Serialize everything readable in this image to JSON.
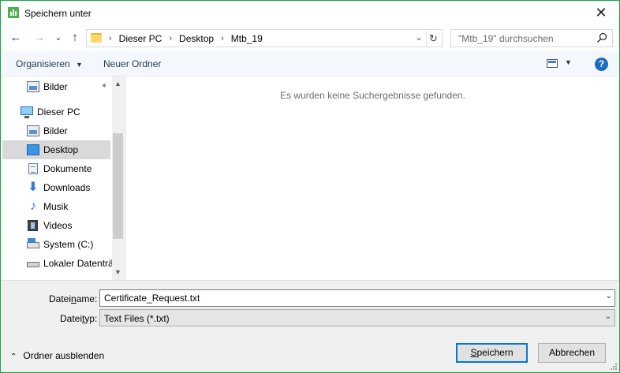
{
  "window": {
    "title": "Speichern unter",
    "close_glyph": "✕",
    "accent_color": "#1aa34a"
  },
  "nav": {
    "back_glyph": "←",
    "forward_glyph": "→",
    "recent_glyph": "⌄",
    "up_glyph": "↑",
    "breadcrumb": [
      "Dieser PC",
      "Desktop",
      "Mtb_19"
    ],
    "breadcrumb_sep": "›",
    "dropdown_glyph": "⌄",
    "refresh_glyph": "↻",
    "search_placeholder": "\"Mtb_19\" durchsuchen"
  },
  "toolbar": {
    "organize_label": "Organisieren",
    "organize_caret": "▼",
    "new_folder_label": "Neuer Ordner",
    "view_caret": "▼",
    "help_glyph": "?"
  },
  "navpane": {
    "items": [
      {
        "label": "Bilder",
        "icon": "pictures-icon",
        "pinned": true
      },
      {
        "label": "Dieser PC",
        "icon": "computer-icon"
      },
      {
        "label": "Bilder",
        "icon": "pictures-icon"
      },
      {
        "label": "Desktop",
        "icon": "desktop-icon",
        "selected": true
      },
      {
        "label": "Dokumente",
        "icon": "documents-icon"
      },
      {
        "label": "Downloads",
        "icon": "download-icon"
      },
      {
        "label": "Musik",
        "icon": "music-icon"
      },
      {
        "label": "Videos",
        "icon": "videos-icon"
      },
      {
        "label": "System (C:)",
        "icon": "drive-icon"
      },
      {
        "label": "Lokaler Datenträ",
        "icon": "drive-icon"
      }
    ],
    "pin_glyph": "📌",
    "down_glyph": "⬇",
    "music_glyph": "♪",
    "scroll_up": "▲",
    "scroll_down": "▼"
  },
  "content": {
    "empty_message": "Es wurden keine Suchergebnisse gefunden."
  },
  "form": {
    "filename_label_pre": "Datei",
    "filename_label_key": "n",
    "filename_label_post": "ame:",
    "filename_value": "Certificate_Request.txt",
    "filetype_label_pre": "Datei",
    "filetype_label_key": "t",
    "filetype_label_post": "yp:",
    "filetype_value": "Text Files (*.txt)",
    "dropdown_glyph": "⌄"
  },
  "footer": {
    "hide_folders_glyph": "⌃",
    "hide_folders_label": "Ordner ausblenden",
    "save_label_key": "S",
    "save_label_rest": "peichern",
    "cancel_label": "Abbrechen"
  }
}
